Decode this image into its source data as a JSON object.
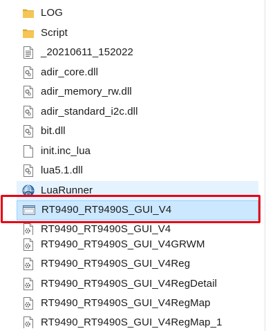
{
  "colors": {
    "folder": "#f6c654",
    "folder_dark": "#dcaa3a",
    "selection": "#cce8ff",
    "selection_border": "#99d1ff",
    "hover": "#e5f3ff",
    "annotation": "#e60012"
  },
  "files": [
    {
      "name": "LOG",
      "icon": "folder-icon"
    },
    {
      "name": "Script",
      "icon": "folder-icon"
    },
    {
      "name": "_20210611_152022",
      "icon": "text-document-icon"
    },
    {
      "name": "adir_core.dll",
      "icon": "dll-icon"
    },
    {
      "name": "adir_memory_rw.dll",
      "icon": "dll-icon"
    },
    {
      "name": "adir_standard_i2c.dll",
      "icon": "dll-icon"
    },
    {
      "name": "bit.dll",
      "icon": "dll-icon"
    },
    {
      "name": "init.inc_lua",
      "icon": "blank-file-icon"
    },
    {
      "name": "lua5.1.dll",
      "icon": "dll-icon"
    },
    {
      "name": "LuaRunner",
      "icon": "globe-app-icon"
    },
    {
      "name": "RT9490_RT9490S_GUI_V4",
      "icon": "application-icon"
    },
    {
      "name": "RT9490_RT9490S_GUI_V4",
      "icon": "config-file-icon"
    },
    {
      "name": "RT9490_RT9490S_GUI_V4GRWM",
      "icon": "config-file-icon"
    },
    {
      "name": "RT9490_RT9490S_GUI_V4Reg",
      "icon": "config-file-icon"
    },
    {
      "name": "RT9490_RT9490S_GUI_V4RegDetail",
      "icon": "config-file-icon"
    },
    {
      "name": "RT9490_RT9490S_GUI_V4RegMap",
      "icon": "config-file-icon"
    },
    {
      "name": "RT9490_RT9490S_GUI_V4RegMap_1",
      "icon": "config-file-icon"
    }
  ],
  "selected_file": "RT9490_RT9490S_GUI_V4"
}
